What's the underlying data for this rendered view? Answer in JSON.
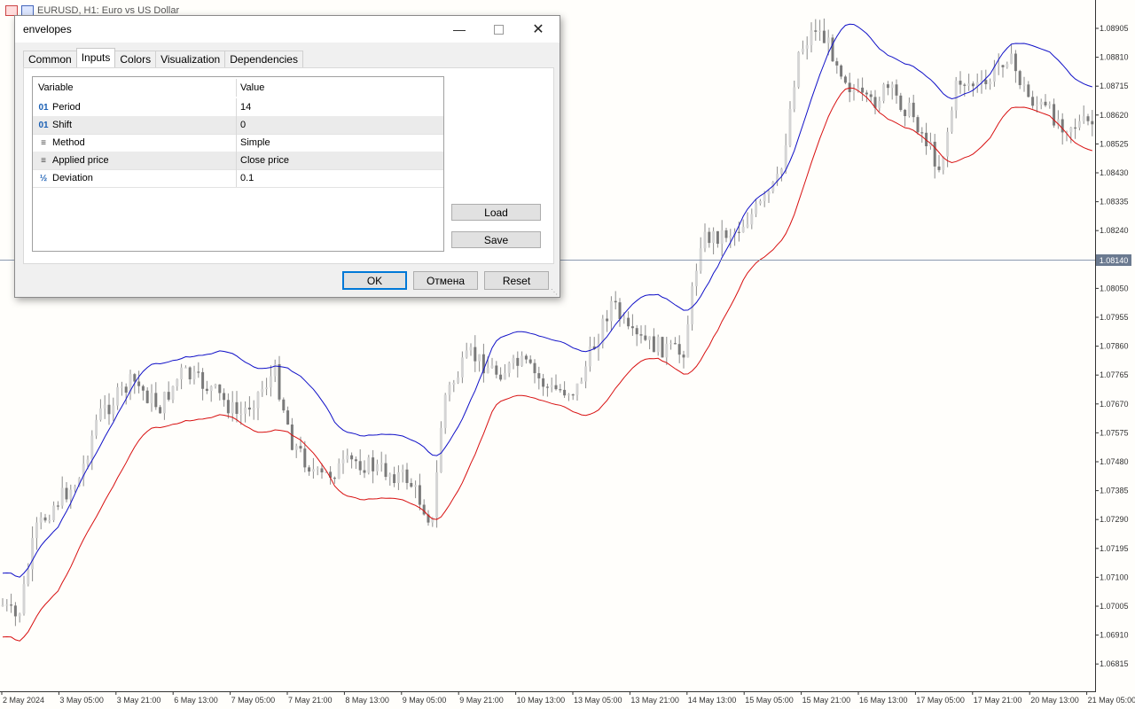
{
  "chart": {
    "title": "EURUSD, H1:  Euro vs US Dollar",
    "current_price": "1.08140",
    "price_labels": [
      "1.08905",
      "1.08810",
      "1.08715",
      "1.08620",
      "1.08525",
      "1.08430",
      "1.08335",
      "1.08240",
      "1.08050",
      "1.07955",
      "1.07860",
      "1.07765",
      "1.07670",
      "1.07575",
      "1.07480",
      "1.07385",
      "1.07290",
      "1.07195",
      "1.07100",
      "1.07005",
      "1.06910",
      "1.06815"
    ],
    "time_labels": [
      "2 May 2024",
      "3 May 05:00",
      "3 May 21:00",
      "6 May 13:00",
      "7 May 05:00",
      "7 May 21:00",
      "8 May 13:00",
      "9 May 05:00",
      "9 May 21:00",
      "10 May 13:00",
      "13 May 05:00",
      "13 May 21:00",
      "14 May 13:00",
      "15 May 05:00",
      "15 May 21:00",
      "16 May 13:00",
      "17 May 05:00",
      "17 May 21:00",
      "20 May 13:00",
      "21 May 05:00"
    ],
    "colors": {
      "upper_envelope": "#1010c8",
      "lower_envelope": "#d81010",
      "candle": "#8c8c8c",
      "price_line": "#8c9ab0",
      "price_label_bg": "#6b7a90"
    }
  },
  "dialog": {
    "title": "envelopes",
    "tabs": [
      "Common",
      "Inputs",
      "Colors",
      "Visualization",
      "Dependencies"
    ],
    "active_tab": "Inputs",
    "table": {
      "headers": {
        "variable": "Variable",
        "value": "Value"
      },
      "rows": [
        {
          "icon": "01",
          "icon_name": "integer-param-icon",
          "variable": "Period",
          "value": "14"
        },
        {
          "icon": "01",
          "icon_name": "integer-param-icon",
          "variable": "Shift",
          "value": "0"
        },
        {
          "icon": "≡",
          "icon_name": "enum-param-icon",
          "variable": "Method",
          "value": "Simple"
        },
        {
          "icon": "≡",
          "icon_name": "enum-param-icon",
          "variable": "Applied price",
          "value": "Close price"
        },
        {
          "icon": "½",
          "icon_name": "double-param-icon",
          "variable": "Deviation",
          "value": "0.1"
        }
      ]
    },
    "buttons": {
      "load": "Load",
      "save": "Save",
      "ok": "OK",
      "cancel": "Отмена",
      "reset": "Reset"
    }
  }
}
